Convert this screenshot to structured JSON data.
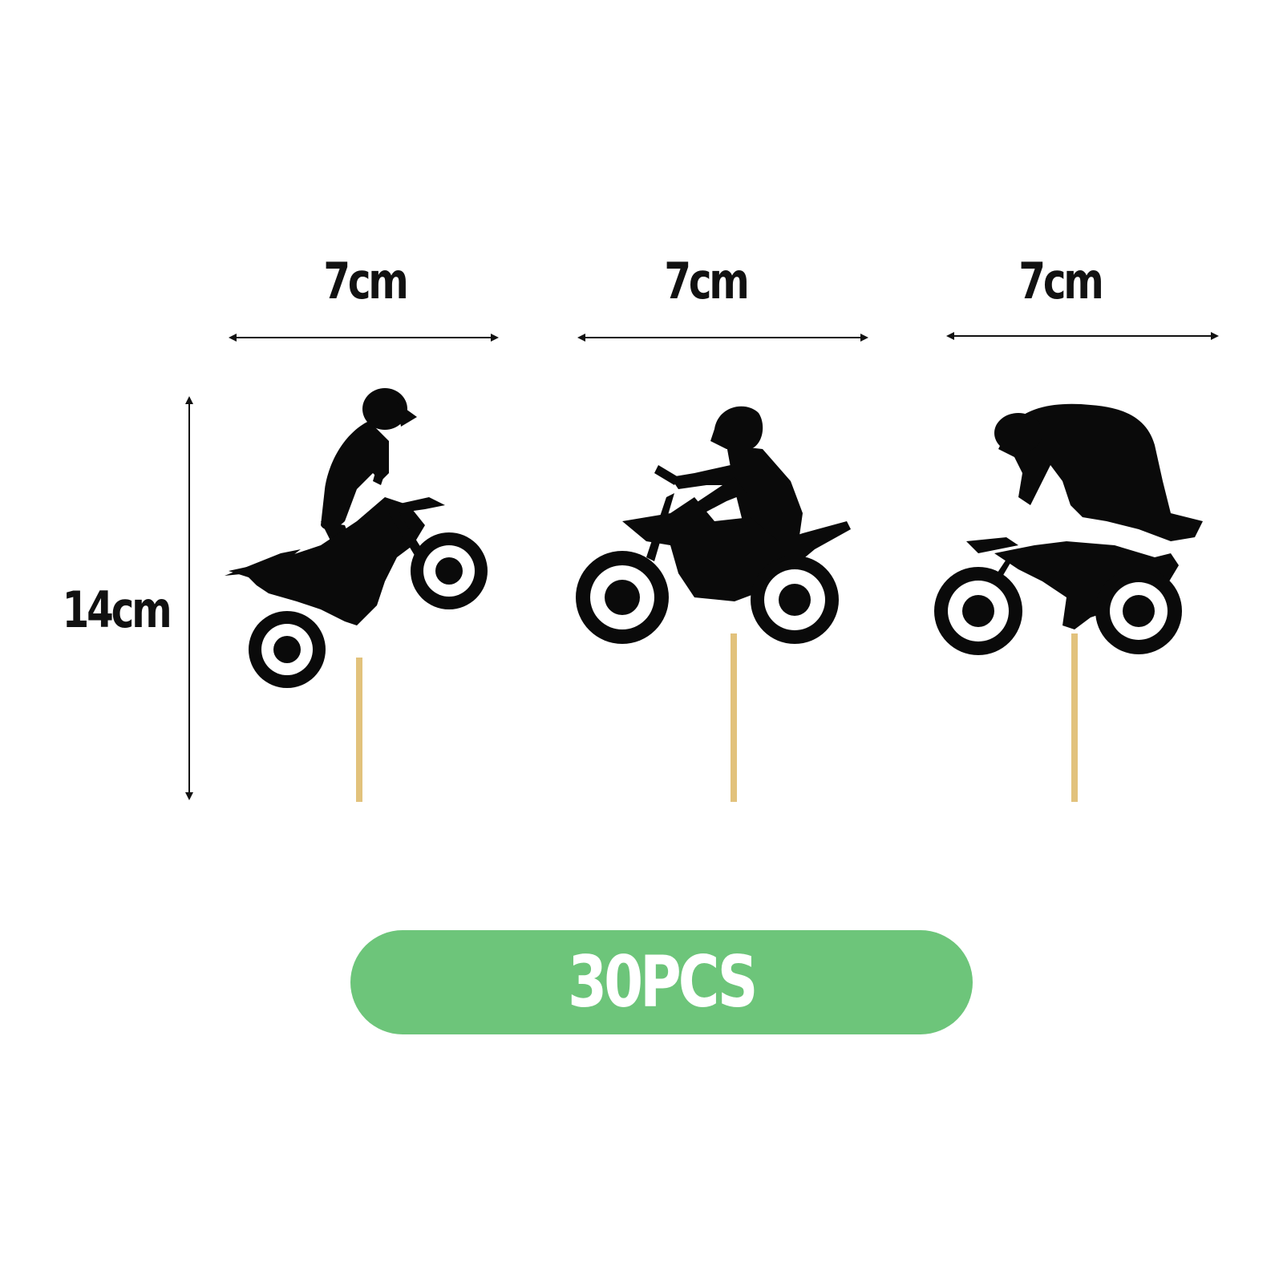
{
  "dimensions": {
    "width_labels": [
      "7cm",
      "7cm",
      "7cm"
    ],
    "height_label": "14cm"
  },
  "quantity_badge": {
    "label": "30PCS",
    "color": "#6dc57a"
  },
  "toppers": [
    {
      "name": "motocross-rider-wheelie"
    },
    {
      "name": "motocross-rider-seated"
    },
    {
      "name": "motocross-rider-standing"
    }
  ],
  "colors": {
    "silhouette": "#0a0a0a",
    "stick": "#e2c27c",
    "arrow": "#111111"
  }
}
